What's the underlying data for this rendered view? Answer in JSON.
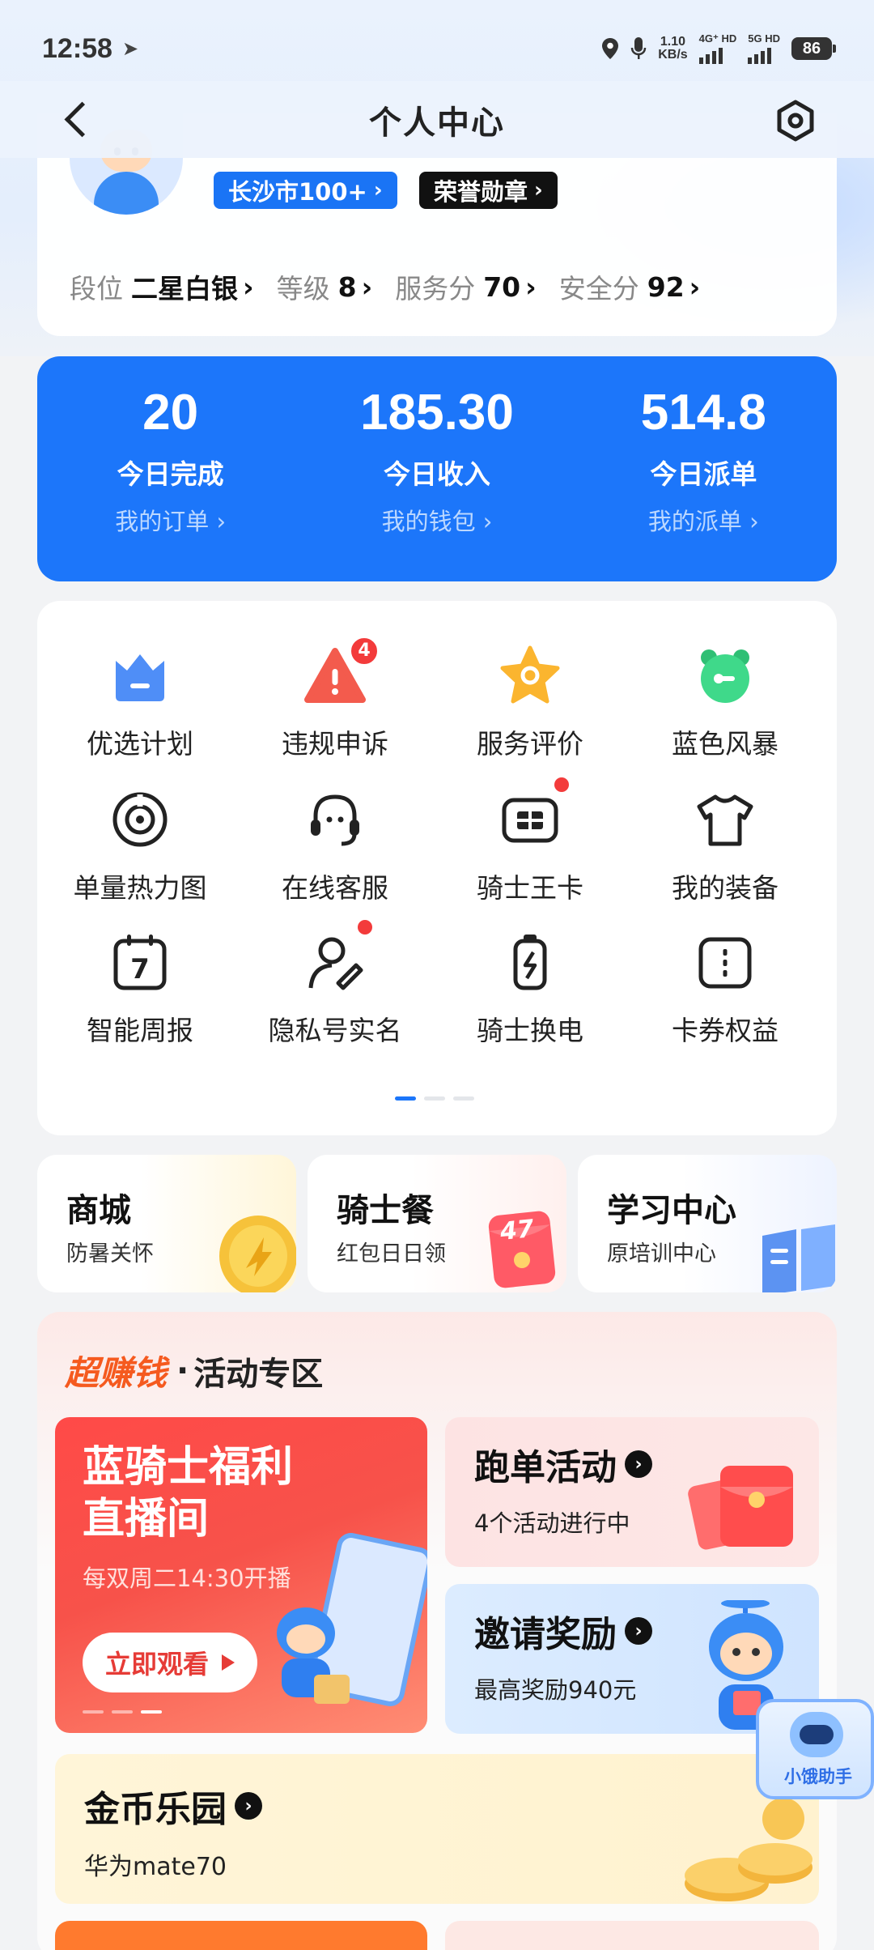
{
  "status_bar": {
    "time": "12:58",
    "net_speed_value": "1.10",
    "net_speed_unit": "KB/s",
    "sim1": "4G⁺ HD",
    "sim2": "5G HD",
    "battery": "86"
  },
  "header": {
    "title": "个人中心"
  },
  "profile": {
    "city_badge": "长沙市100+",
    "honor_badge": "荣誉勋章",
    "stats": [
      {
        "label": "段位",
        "value": "二星白银"
      },
      {
        "label": "等级",
        "value": "8"
      },
      {
        "label": "服务分",
        "value": "70"
      },
      {
        "label": "安全分",
        "value": "92"
      }
    ]
  },
  "summary": [
    {
      "value": "20",
      "label": "今日完成",
      "link": "我的订单"
    },
    {
      "value": "185.30",
      "label": "今日收入",
      "link": "我的钱包"
    },
    {
      "value": "514.8",
      "label": "今日派单",
      "link": "我的派单"
    }
  ],
  "grid": [
    {
      "label": "优选计划",
      "icon": "crown-icon"
    },
    {
      "label": "违规申诉",
      "icon": "alert-triangle-icon",
      "badge": "4"
    },
    {
      "label": "服务评价",
      "icon": "star-icon"
    },
    {
      "label": "蓝色风暴",
      "icon": "alarm-clock-icon"
    },
    {
      "label": "单量热力图",
      "icon": "target-icon"
    },
    {
      "label": "在线客服",
      "icon": "headset-icon"
    },
    {
      "label": "骑士王卡",
      "icon": "card-icon"
    },
    {
      "label": "我的装备",
      "icon": "tshirt-icon"
    },
    {
      "label": "智能周报",
      "icon": "calendar-icon",
      "calendar_num": "7"
    },
    {
      "label": "隐私号实名",
      "icon": "user-privacy-icon"
    },
    {
      "label": "骑士换电",
      "icon": "battery-swap-icon"
    },
    {
      "label": "卡券权益",
      "icon": "coupon-icon"
    }
  ],
  "mini_cards": [
    {
      "title": "商城",
      "sub": "防暑关怀"
    },
    {
      "title": "骑士餐",
      "sub": "红包日日领",
      "badge": "47"
    },
    {
      "title": "学习中心",
      "sub": "原培训中心"
    }
  ],
  "activity": {
    "hot": "超赚钱",
    "sep": "·",
    "title": "活动专区",
    "live": {
      "title_line1": "蓝骑士福利",
      "title_line2": "直播间",
      "sub": "每双周二14:30开播",
      "button": "立即观看"
    },
    "run": {
      "title": "跑单活动",
      "sub": "4个活动进行中"
    },
    "invite": {
      "title": "邀请奖励",
      "sub": "最高奖励940元"
    },
    "coins": {
      "title": "金币乐园",
      "sub": "华为mate70"
    }
  },
  "helper": {
    "label": "小饿助手"
  },
  "colors": {
    "primary": "#1c76fa",
    "accent_orange": "#f55a1f",
    "badge_red": "#f33b3b"
  }
}
